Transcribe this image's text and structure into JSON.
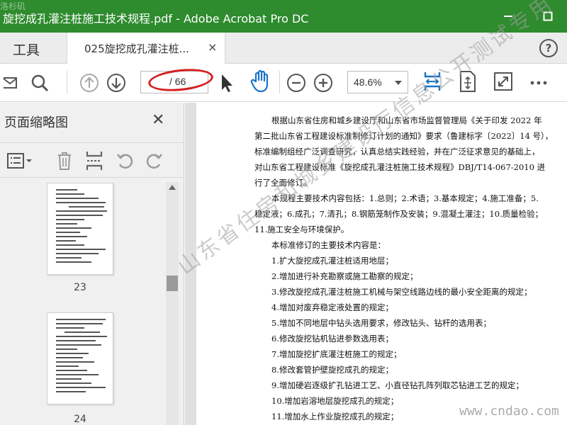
{
  "window": {
    "title": "旋挖成孔灌注桩施工技术规程.pdf - Adobe Acrobat Pro DC"
  },
  "tabs": {
    "tools_label": "工具",
    "document_label": "025旋挖成孔灌注桩...",
    "close_glyph": "×",
    "help_glyph": "?"
  },
  "toolbar": {
    "page_current": "",
    "page_total": "/ 66",
    "zoom": "48.6%"
  },
  "sidebar": {
    "title": "页面缩略图",
    "close_glyph": "✕",
    "thumbnails": [
      {
        "label": "23"
      },
      {
        "label": "24"
      }
    ]
  },
  "document": {
    "lines": [
      "根据山东省住房和城乡建设厅和山东省市场监督管理局《关于印发 2022 年",
      "第二批山东省工程建设标准制修订计划的通知》要求（鲁建标字〔2022〕14 号），",
      "标准编制组经广泛调查研究，认真总结实践经验，并在广泛征求意见的基础上，",
      "对山东省工程建设标准《旋挖成孔灌注桩施工技术规程》DBJ/T14-067-2010 进",
      "行了全面修订。",
      "本规程主要技术内容包括：1.总则；2.术语；3.基本规定；4.施工准备；5.",
      "稳定液；6.成孔；7.清孔；8.钢筋笼制作及安装；9.混凝土灌注；10.质量检验；",
      "11.施工安全与环境保护。",
      "本标准修订的主要技术内容是：",
      "1.扩大旋挖成孔灌注桩适用地层；",
      "2.增加进行补充勘察或施工勘察的规定；",
      "3.修改旋挖成孔灌注桩施工机械与架空线路边线的最小安全距离的规定；",
      "4.增加对废弃稳定液处置的规定；",
      "5.增加不同地层中钻头选用要求，修改钻头、钻杆的选用表；",
      "6.修改旋挖钻机钻进参数选用表；",
      "7.增加旋挖扩底灌注桩施工的规定；",
      "8.修改套管护壁旋挖成孔的规定；",
      "9.增加硬岩逐级扩孔钻进工艺、小直径钻孔阵列取芯钻进工艺的规定；",
      "10.增加岩溶地层旋挖成孔的规定；",
      "11.增加水上作业旋挖成孔的规定；"
    ]
  },
  "watermark": {
    "diagonal": "山东省住房和城乡建设厅信息公开测试专用",
    "site": "www.cndao.com",
    "corner": "洛杉矶"
  },
  "colors": {
    "titlebar": "#2e8b2e",
    "accent_blue": "#1a73c8",
    "highlight_ring": "#d42020"
  }
}
